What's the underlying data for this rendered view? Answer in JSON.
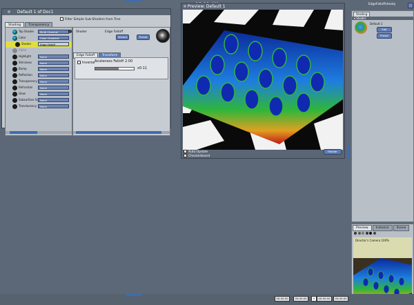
{
  "clock": "12:11 AM",
  "material_window": {
    "title": "Default 1 of Doc1",
    "filter_label": "Filter Simple Sub-Shaders from Tree",
    "tabs": [
      "Shading",
      "Transparency"
    ],
    "tree_rows": [
      {
        "label": "Top Shader",
        "value": "Multi Channel"
      },
      {
        "label": "Color",
        "value": "Color Gradient"
      },
      {
        "label": "Shader",
        "value": "Edge Falloff"
      },
      {
        "label": "Alpha",
        "value": ""
      },
      {
        "label": "Highlight",
        "value": "None"
      },
      {
        "label": "Shininess",
        "value": "None"
      },
      {
        "label": "Bump",
        "value": "None"
      },
      {
        "label": "Reflection",
        "value": "None"
      },
      {
        "label": "Transparency",
        "value": "None"
      },
      {
        "label": "Refraction",
        "value": "None"
      },
      {
        "label": "Glow",
        "value": "None"
      },
      {
        "label": "Subsurface Sc",
        "value": "None"
      },
      {
        "label": "Translucency",
        "value": "None"
      }
    ],
    "shader_name_label": "Shader",
    "shader_value": "Edge Falloff",
    "wizard_label": "Wizard",
    "preset_label": "Preset",
    "inner_tabs": [
      "Edge Falloff",
      "Transform"
    ],
    "inverse_label": "Inverse",
    "acuteness_label": "Acuteness Falloff",
    "acuteness_value": "2.00",
    "acuteness_level": 0.6,
    "secondary_value": "x0.11"
  },
  "preview_window": {
    "title": "Preview: Default 1",
    "auto_update_label": "Auto Update",
    "checkerboard_label": "Checkerboard",
    "render_label": "Render"
  },
  "right_panel": {
    "title": "EdgeFalloffsheaty",
    "tab": "Shading",
    "section": "Shader",
    "item_label": "Default 1",
    "edit_label": "Edit",
    "preset_label": "Preset",
    "preview_tabs": [
      "Preview",
      "Instance",
      "Scene"
    ],
    "camera_label": "Director's Camera 100%"
  },
  "bottom": {
    "time1": "00:00:00",
    "time2": "00:00:00",
    "time3": "00:00:00",
    "time4": "00:00:00"
  },
  "colors": {
    "accent": "#3f6bb0",
    "selection": "#dede44"
  }
}
